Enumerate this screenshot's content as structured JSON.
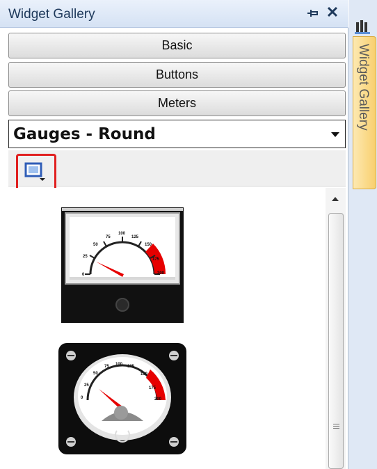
{
  "panel": {
    "title": "Widget Gallery",
    "pin_icon": "pin-icon",
    "close_icon": "close-icon",
    "close_symbol": "✕"
  },
  "categories": [
    {
      "label": "Basic"
    },
    {
      "label": "Buttons"
    },
    {
      "label": "Meters"
    }
  ],
  "dropdown": {
    "value": "Gauges - Round"
  },
  "toolbar": {
    "view_icon": "view-mode-icon"
  },
  "gallery": {
    "gauge1": {
      "ticks": [
        "0",
        "25",
        "50",
        "75",
        "100",
        "125",
        "150",
        "175",
        "200"
      ]
    },
    "gauge2": {
      "ticks": [
        "0",
        "25",
        "50",
        "75",
        "100",
        "125",
        "150",
        "175",
        "200"
      ]
    }
  },
  "side_tab": {
    "label": "Widget Gallery"
  },
  "colors": {
    "accent_red": "#e60000",
    "title_text": "#1e395b",
    "side_tab": "#f8cf6e"
  }
}
